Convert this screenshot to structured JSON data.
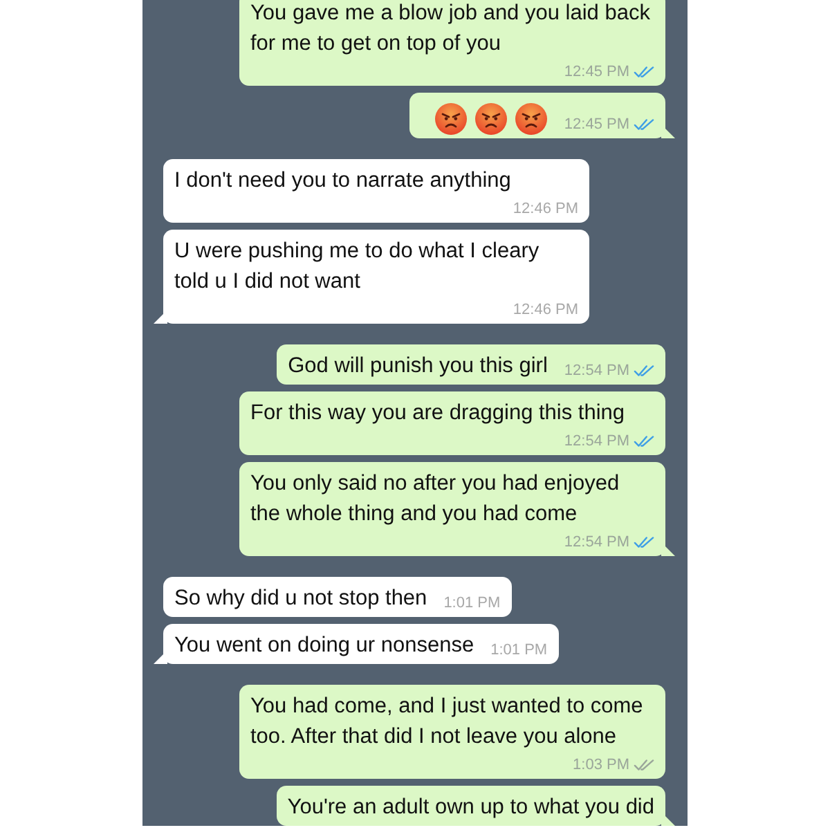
{
  "messages": [
    {
      "outgoing": true,
      "kind": "text",
      "text": "You gave me a blow job and you laid back for me to get on top of you",
      "time": "12:45 PM",
      "read": true
    },
    {
      "outgoing": true,
      "kind": "emoji",
      "emojis": [
        {
          "kind": "angry"
        },
        {
          "kind": "angry"
        },
        {
          "kind": "angry"
        }
      ],
      "time": "12:45 PM",
      "read": true
    },
    {
      "outgoing": false,
      "kind": "text",
      "text": "I don't need you to narrate anything",
      "time": "12:46 PM"
    },
    {
      "outgoing": false,
      "kind": "text",
      "text": "U were pushing me to do what I cleary told u I did not want",
      "time": "12:46 PM"
    },
    {
      "outgoing": true,
      "kind": "text",
      "text": "God will punish you this girl",
      "time": "12:54 PM",
      "read": true
    },
    {
      "outgoing": true,
      "kind": "text",
      "text": "For this way you are dragging this thing",
      "time": "12:54 PM",
      "read": true
    },
    {
      "outgoing": true,
      "kind": "text",
      "text": "You only said no after you had enjoyed the whole thing and you had come",
      "time": "12:54 PM",
      "read": true
    },
    {
      "outgoing": false,
      "kind": "text",
      "text": "So why did u not stop then",
      "time": "1:01 PM"
    },
    {
      "outgoing": false,
      "kind": "text",
      "text": "You went on doing ur nonsense",
      "time": "1:01 PM"
    },
    {
      "outgoing": true,
      "kind": "text",
      "text": "You had come, and I just wanted to come too. After that did I not leave you alone",
      "time": "1:03 PM",
      "read": false
    },
    {
      "outgoing": true,
      "kind": "text",
      "text": "You're an adult own up to what you did"
    }
  ]
}
